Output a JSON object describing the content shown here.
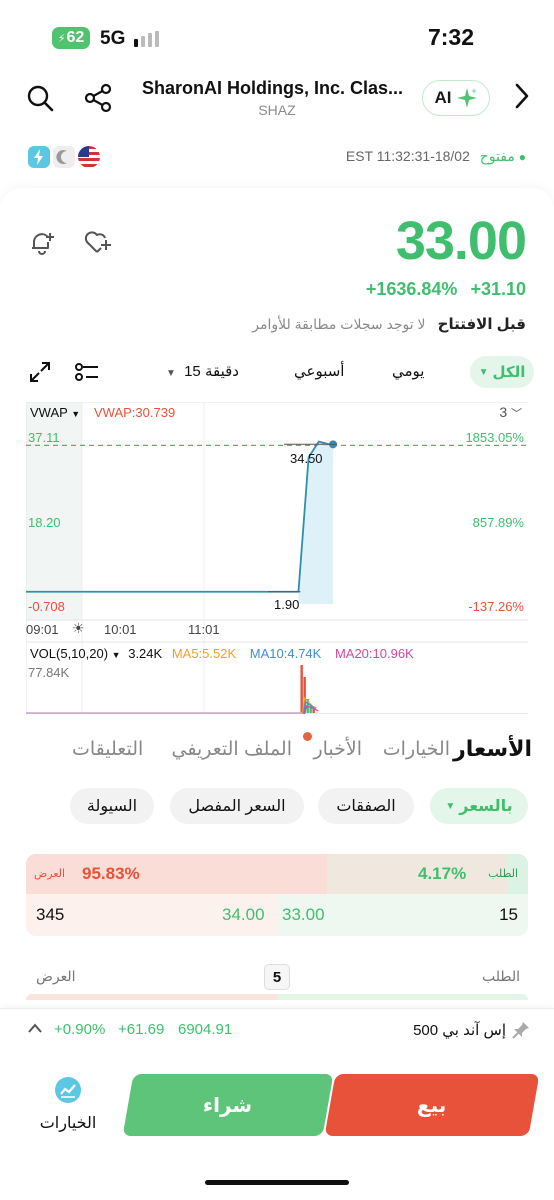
{
  "status_bar": {
    "battery": "62",
    "network": "5G",
    "time": "7:32"
  },
  "header": {
    "title": "SharonAI Holdings, Inc. Clas...",
    "ticker": "SHAZ",
    "ai_label": "AI"
  },
  "market": {
    "status": "مفتوح",
    "timestamp": "EST 11:32:31-18/02"
  },
  "quote": {
    "price": "33.00",
    "change": "+31.10",
    "change_pct": "+1636.84%",
    "session_label": "قبل الافتتاح",
    "no_orders": "لا توجد سجلات مطابقة للأوامر"
  },
  "chart_tabs": {
    "all": "الكل",
    "daily": "يومي",
    "weekly": "أسبوعي",
    "interval": "15 دقيقة"
  },
  "chart_data": {
    "type": "line",
    "indicator": "VWAP",
    "vwap_label": "VWAP:30.739",
    "left_axis": [
      "37.11",
      "18.20",
      "-0.708"
    ],
    "right_axis": [
      "1853.05%",
      "857.89%",
      "-137.26%"
    ],
    "x_labels": [
      "09:01",
      "10:01",
      "11:01"
    ],
    "high_label": "34.50",
    "low_label": "1.90",
    "series_count": "3",
    "ylim": [
      -0.708,
      37.11
    ],
    "x": [
      "09:01",
      "10:01",
      "11:01",
      "11:15",
      "11:20",
      "11:25",
      "11:32"
    ],
    "values": [
      1.9,
      1.9,
      1.9,
      1.9,
      30.5,
      33.8,
      33.0
    ],
    "previous_close": 33.0,
    "volume": {
      "label": "VOL(5,10,20)",
      "value": "3.24K",
      "ma5": "MA5:5.52K",
      "ma10": "MA10:4.74K",
      "ma20": "MA20:10.96K",
      "max": "77.84K"
    }
  },
  "section_tabs": [
    "الأسعار",
    "الخيارات",
    "الأخبار",
    "الملف التعريفي",
    "التعليقات"
  ],
  "sub_tabs": {
    "price": "بالسعر",
    "trades": "الصفقات",
    "detailed": "السعر المفصل",
    "liquidity": "السيولة"
  },
  "order_book": {
    "bid_label": "الطلب",
    "bid_pct": "4.17%",
    "ask_label": "العرض",
    "ask_pct": "95.83%",
    "bid_size": "15",
    "bid_price": "33.00",
    "ask_price": "34.00",
    "ask_size": "345",
    "depth": "5",
    "depth_bid_label": "الطلب",
    "depth_ask_label": "العرض"
  },
  "index_bar": {
    "name": "إس آند بي 500",
    "value": "6904.91",
    "change": "+61.69",
    "change_pct": "+0.90%"
  },
  "actions": {
    "sell": "بيع",
    "buy": "شراء",
    "options": "الخيارات"
  },
  "colors": {
    "green": "#3fbf6e",
    "red": "#e8523a",
    "line": "#2f8fb0",
    "vwap": "#e8523a"
  }
}
